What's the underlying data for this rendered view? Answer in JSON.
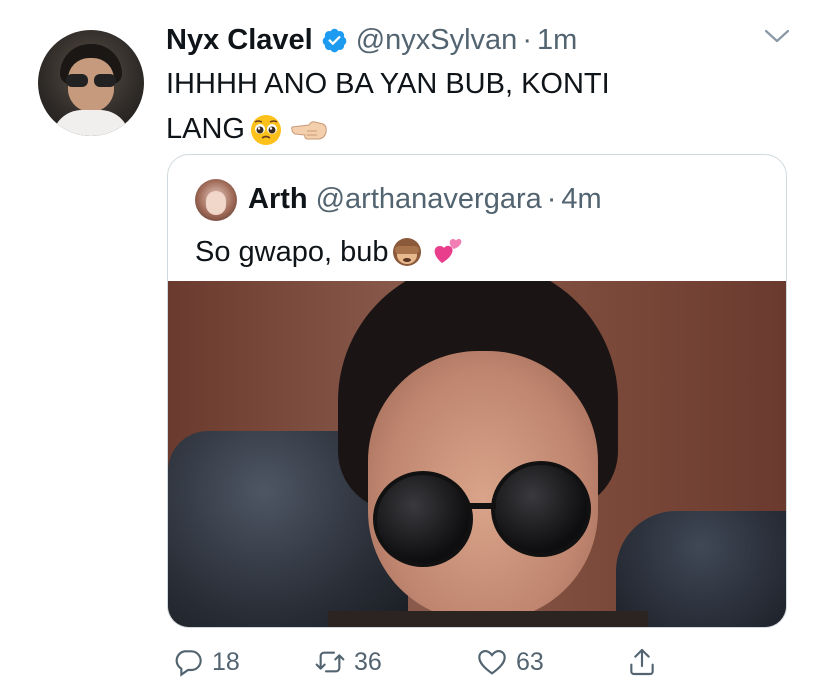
{
  "tweet": {
    "author_name": "Nyx Clavel",
    "handle": "@nyxSylvan",
    "separator": "·",
    "time": "1m",
    "text_line1": "IHHHH ANO BA YAN BUB, KONTI",
    "text_line2": "LANG",
    "emoji_1": "pleading-face",
    "emoji_2": "backhand-index-pointing-left"
  },
  "quoted": {
    "author_name": "Arth",
    "handle": "@arthanavergara",
    "separator": "·",
    "time": "4m",
    "text": "So gwapo, bub",
    "emoji_1": "see-no-evil-monkey",
    "emoji_2": "two-hearts"
  },
  "actions": {
    "reply_count": "18",
    "retweet_count": "36",
    "like_count": "63"
  },
  "colors": {
    "verified": "#1d9bf0",
    "secondary_text": "#536471",
    "border": "#cfd9de"
  }
}
